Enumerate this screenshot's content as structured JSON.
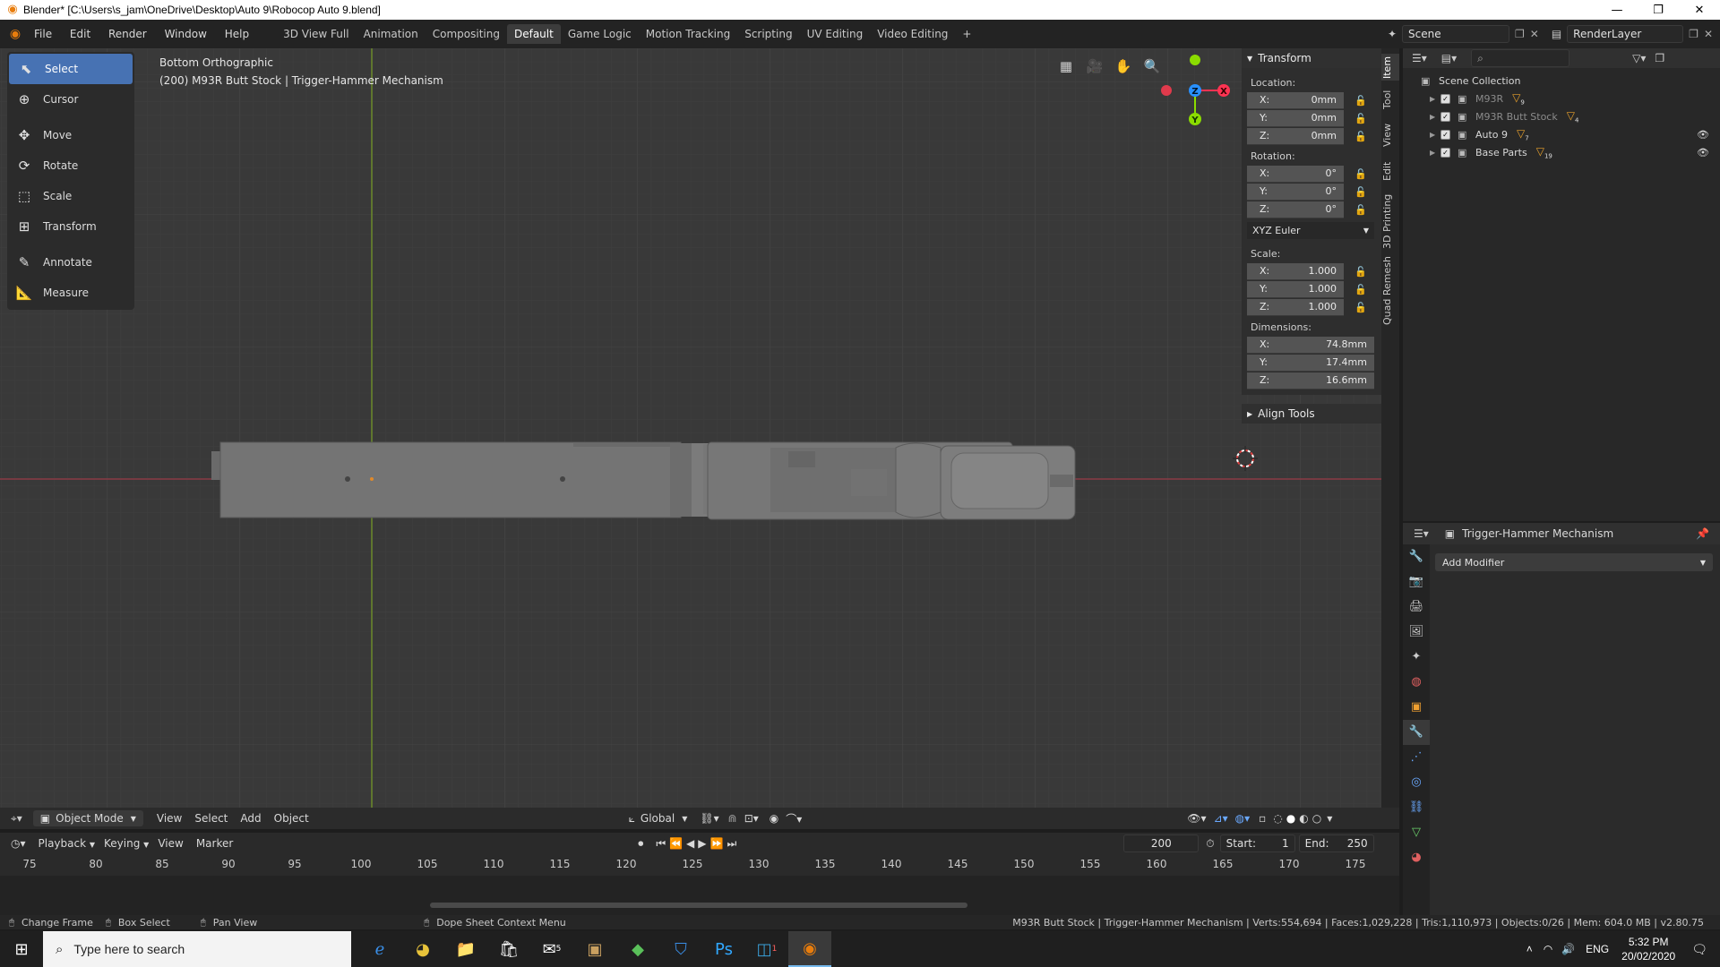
{
  "window": {
    "title": "Blender* [C:\\Users\\s_jam\\OneDrive\\Desktop\\Auto 9\\Robocop Auto 9.blend]"
  },
  "topbar": {
    "menus": [
      "File",
      "Edit",
      "Render",
      "Window",
      "Help"
    ],
    "workspaces": [
      "3D View Full",
      "Animation",
      "Compositing",
      "Default",
      "Game Logic",
      "Motion Tracking",
      "Scripting",
      "UV Editing",
      "Video Editing"
    ],
    "active_workspace": "Default",
    "add_label": "+",
    "scene": "Scene",
    "view_layer": "RenderLayer"
  },
  "viewport": {
    "view_name": "Bottom Orthographic",
    "object_info": "(200) M93R Butt Stock | Trigger-Hammer Mechanism",
    "tools": [
      "Select",
      "Cursor",
      "Move",
      "Rotate",
      "Scale",
      "Transform",
      "Annotate",
      "Measure"
    ],
    "active_tool": "Select",
    "gizmo": {
      "x": "X",
      "y": "Y",
      "z": "Z"
    }
  },
  "transform": {
    "title": "Transform",
    "location_label": "Location:",
    "rotation_label": "Rotation:",
    "scale_label": "Scale:",
    "dimensions_label": "Dimensions:",
    "location": [
      {
        "axis": "X:",
        "value": "0mm"
      },
      {
        "axis": "Y:",
        "value": "0mm"
      },
      {
        "axis": "Z:",
        "value": "0mm"
      }
    ],
    "rotation": [
      {
        "axis": "X:",
        "value": "0°"
      },
      {
        "axis": "Y:",
        "value": "0°"
      },
      {
        "axis": "Z:",
        "value": "0°"
      }
    ],
    "rotation_mode": "XYZ Euler",
    "scale": [
      {
        "axis": "X:",
        "value": "1.000"
      },
      {
        "axis": "Y:",
        "value": "1.000"
      },
      {
        "axis": "Z:",
        "value": "1.000"
      }
    ],
    "dimensions": [
      {
        "axis": "X:",
        "value": "74.8mm"
      },
      {
        "axis": "Y:",
        "value": "17.4mm"
      },
      {
        "axis": "Z:",
        "value": "16.6mm"
      }
    ],
    "align_tools": "Align Tools"
  },
  "side_tabs": [
    "Item",
    "Tool",
    "View",
    "Edit",
    "3D Printing",
    "Quad Remesh"
  ],
  "viewport_header": {
    "mode": "Object Mode",
    "menus": [
      "View",
      "Select",
      "Add",
      "Object"
    ],
    "orientation": "Global"
  },
  "timeline": {
    "menus": [
      "Playback",
      "Keying",
      "View",
      "Marker"
    ],
    "current_frame": "200",
    "start_label": "Start:",
    "start": "1",
    "end_label": "End:",
    "end": "250",
    "ruler": [
      "75",
      "80",
      "85",
      "90",
      "95",
      "100",
      "105",
      "110",
      "115",
      "120",
      "125",
      "130",
      "135",
      "140",
      "145",
      "150",
      "155",
      "160",
      "165",
      "170",
      "175"
    ]
  },
  "outliner": {
    "root": "Scene Collection",
    "items": [
      {
        "name": "M93R",
        "badge": "9",
        "dim": true,
        "visible": false
      },
      {
        "name": "M93R Butt Stock",
        "badge": "4",
        "dim": true,
        "visible": false
      },
      {
        "name": "Auto 9",
        "badge": "7",
        "dim": false,
        "visible": true
      },
      {
        "name": "Base Parts",
        "badge": "19",
        "dim": false,
        "visible": true
      }
    ]
  },
  "properties": {
    "object_name": "Trigger-Hammer Mechanism",
    "add_modifier": "Add Modifier"
  },
  "statusbar": {
    "hints": [
      "Change Frame",
      "Box Select",
      "Pan View",
      "Dope Sheet Context Menu"
    ],
    "stats": "M93R Butt Stock | Trigger-Hammer Mechanism | Verts:554,694 | Faces:1,029,228 | Tris:1,110,973 | Objects:0/26 | Mem: 604.0 MB | v2.80.75"
  },
  "taskbar": {
    "search_placeholder": "Type here to search",
    "mail_badge": "5",
    "app_badge": "1",
    "language": "ENG",
    "time": "5:32 PM",
    "date": "20/02/2020"
  },
  "colors": {
    "accent": "#4772b3",
    "x_axis": "#ff3352",
    "y_axis": "#8bdc00",
    "z_axis": "#2890ff",
    "blender_orange": "#e87d0d"
  }
}
